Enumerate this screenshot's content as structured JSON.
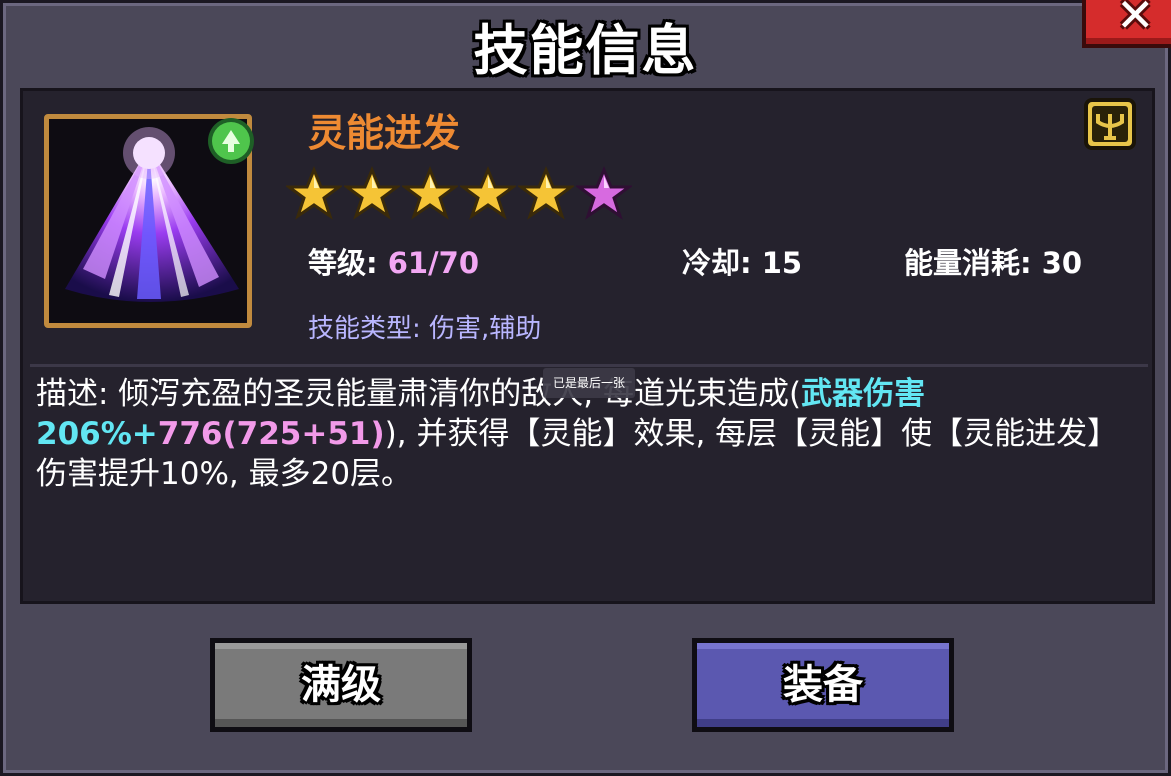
{
  "dialog": {
    "title": "技能信息",
    "close_icon": "close-x-icon"
  },
  "skill": {
    "name": "灵能进发",
    "name_color": "#ee8a32",
    "icon": "psionic-burst-icon",
    "rarity_badge_icon": "green-gem-icon",
    "corner_icon": "trident-rune-icon",
    "stars": {
      "gold": 5,
      "purple": 1,
      "total": 6
    },
    "level_label": "等级: ",
    "level_value": "61/70",
    "cooldown_label": "冷却: ",
    "cooldown_value": "15",
    "energy_label": "能量消耗: ",
    "energy_value": "30",
    "type_line": "技能类型: 伤害,辅助"
  },
  "description": {
    "part1": "描述: 倾泻充盈的圣灵能量肃清你的敌人, 每道光束造成(",
    "weapon_damage": "武器伤害206%",
    "plus": "+",
    "base_damage": "776(725+51)",
    "part2": "), 并获得【灵能】效果, 每层【灵能】使【灵能进发】伤害提升10%, 最多20层。"
  },
  "tooltip": {
    "text": "已是最后一张"
  },
  "buttons": {
    "max_level": "满级",
    "equip": "装备"
  },
  "colors": {
    "background": "#4b4859",
    "panel": "#25222d",
    "cyan_highlight": "#62e6f3",
    "pink_highlight": "#f29ae9",
    "level_value": "#f2a7f3",
    "type_text": "#b9b6ff",
    "close_button": "#d52c2c",
    "equip_button": "#5b58b0",
    "max_button": "#7a7a7a"
  }
}
